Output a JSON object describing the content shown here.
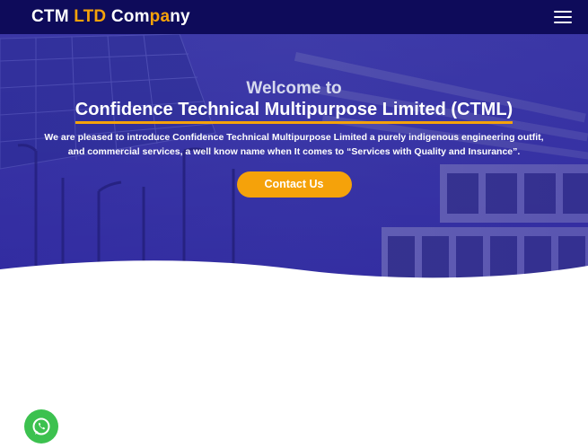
{
  "navbar": {
    "brand_part1": "CTM ",
    "brand_part2": "LTD",
    "brand_part3": " Com",
    "brand_part4": "pa",
    "brand_part5": "ny",
    "menu_icon": "hamburger-menu-icon"
  },
  "hero": {
    "welcome": "Welcome to",
    "company_title": "Confidence Technical Multipurpose Limited (CTML)",
    "intro": "We are pleased to introduce Confidence Technical Multipurpose Limited a purely indigenous engineering outfit, and commercial services, a well know name when It comes to “Services with Quality and Insurance”.",
    "contact_button": "Contact Us"
  },
  "floating": {
    "whatsapp_icon": "whatsapp-icon"
  },
  "colors": {
    "navbar_bg": "#0e0b5a",
    "accent": "#f5a20a",
    "hero_overlay": "#2a1f9a",
    "whatsapp": "#3cc14f"
  }
}
